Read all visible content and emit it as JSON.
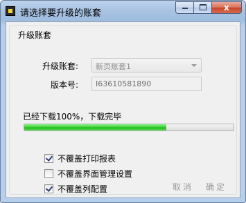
{
  "window": {
    "title": "请选择要升级的账套",
    "close_glyph": "x"
  },
  "group": {
    "title": "升级账套"
  },
  "form": {
    "account_label": "升级账套:",
    "account_value": "新页账套1",
    "version_label": "版本号:",
    "version_value": "I63610581890"
  },
  "download": {
    "status_text": "已经下载100%，下载完毕",
    "progress_fraction": 0.68,
    "progress_color": "#20b91c"
  },
  "options": [
    {
      "label": "不覆盖打印报表",
      "checked": true
    },
    {
      "label": "不覆盖界面管理设置",
      "checked": false
    },
    {
      "label": "不覆盖列配置",
      "checked": true
    }
  ],
  "buttons": {
    "cancel_label": "取消",
    "ok_label": "确定"
  }
}
